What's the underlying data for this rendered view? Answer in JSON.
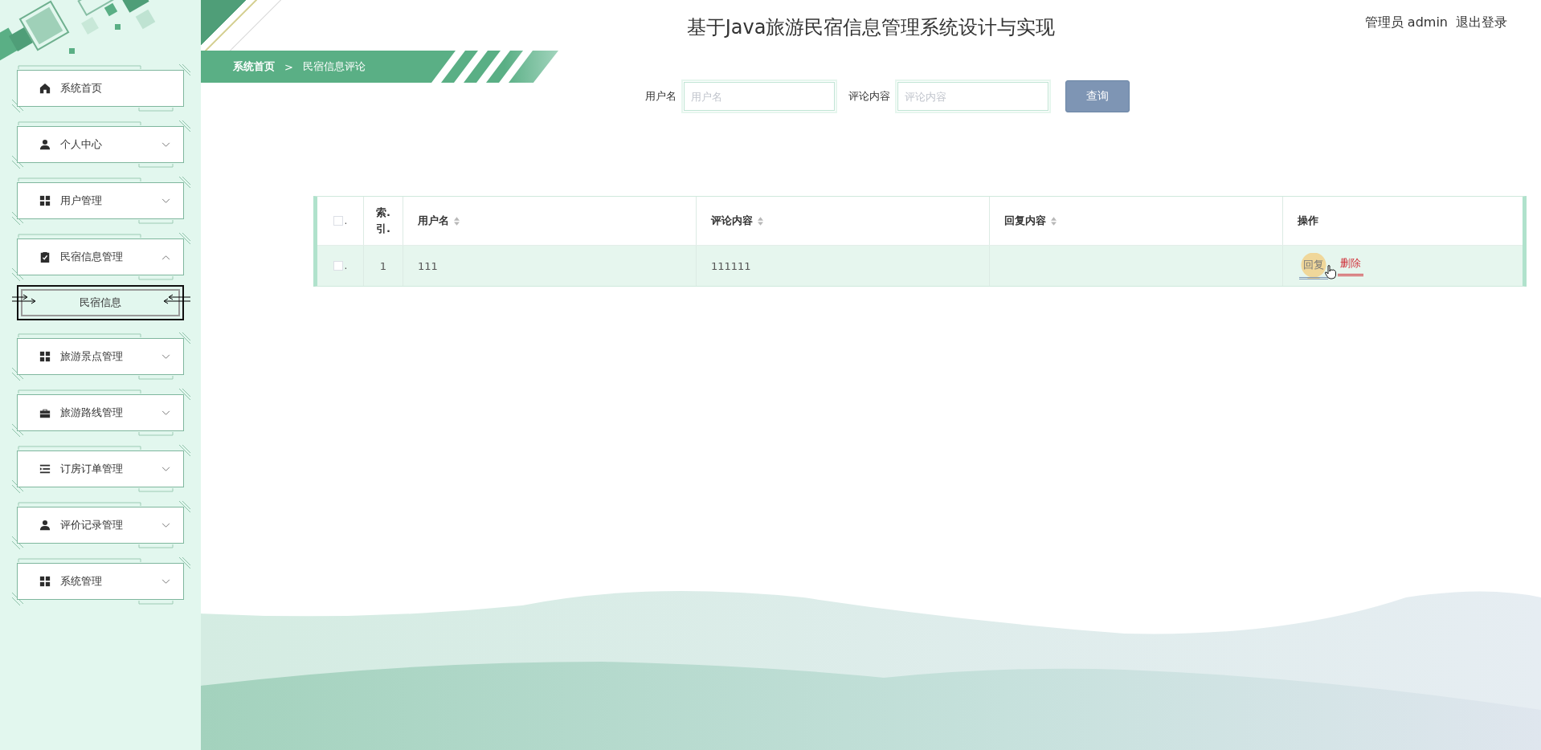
{
  "header": {
    "title": "基于Java旅游民宿信息管理系统设计与实现",
    "user": "管理员 admin",
    "logout": "退出登录"
  },
  "sidebar": {
    "items": [
      {
        "label": "系统首页"
      },
      {
        "label": "个人中心",
        "expanded": false
      },
      {
        "label": "用户管理",
        "expanded": false
      },
      {
        "label": "民宿信息管理",
        "expanded": true,
        "children": [
          {
            "label": "民宿信息",
            "selected": true
          }
        ]
      },
      {
        "label": "旅游景点管理",
        "expanded": false
      },
      {
        "label": "旅游路线管理",
        "expanded": false
      },
      {
        "label": "订房订单管理",
        "expanded": false
      },
      {
        "label": "评价记录管理",
        "expanded": false
      },
      {
        "label": "系统管理",
        "expanded": false
      }
    ]
  },
  "breadcrumb": {
    "items": [
      "系统首页",
      "民宿信息评论"
    ],
    "separator": ">"
  },
  "search": {
    "fields": [
      {
        "label": "用户名",
        "placeholder": "用户名"
      },
      {
        "label": "评论内容",
        "placeholder": "评论内容"
      }
    ],
    "button": "查询"
  },
  "table": {
    "select_all": {
      "checked": false,
      "label": "."
    },
    "columns": [
      {
        "label": "索.\n引.",
        "sortable": false
      },
      {
        "label": "用户名",
        "sortable": true
      },
      {
        "label": "评论内容",
        "sortable": true
      },
      {
        "label": "回复内容",
        "sortable": true
      },
      {
        "label": "操作",
        "sortable": false
      }
    ],
    "rows": [
      {
        "select": {
          "checked": false,
          "label": "."
        },
        "cells": [
          "1",
          "111",
          "111111",
          ""
        ],
        "actions": [
          {
            "label": "回复",
            "kind": "reply",
            "hovered": true
          },
          {
            "label": "删除",
            "kind": "delete",
            "hovered": false
          }
        ]
      }
    ]
  }
}
